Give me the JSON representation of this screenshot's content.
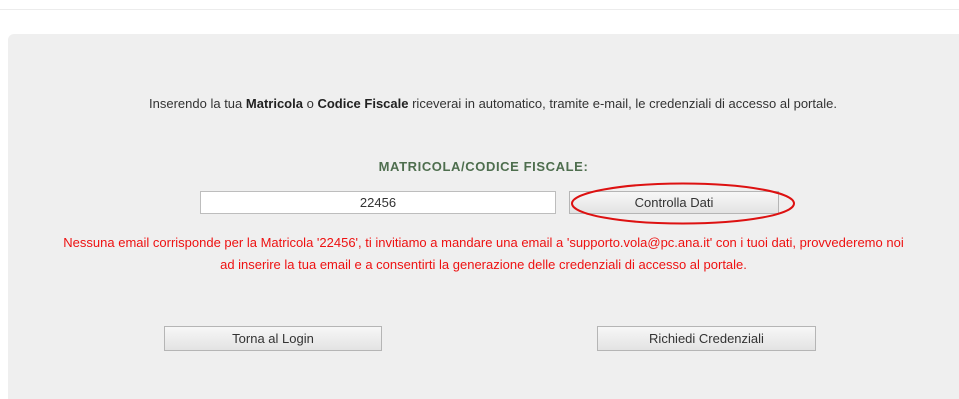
{
  "intro": {
    "part1": "Inserendo la tua ",
    "bold1": "Matricola",
    "part2": " o ",
    "bold2": "Codice Fiscale",
    "part3": " riceverai in automatico, tramite e-mail, le credenziali di accesso al portale."
  },
  "form": {
    "label": "MATRICOLA/CODICE FISCALE:",
    "input_value": "22456",
    "check_button": "Controlla Dati"
  },
  "error_message": "Nessuna email corrisponde per la Matricola '22456', ti invitiamo a mandare una email a 'supporto.vola@pc.ana.it' con i tuoi dati, provvederemo noi ad inserire la tua email e a consentirti la generazione delle credenziali di accesso al portale.",
  "actions": {
    "back_button": "Torna al Login",
    "request_button": "Richiedi Credenziali"
  },
  "colors": {
    "error": "#ee1111",
    "label": "#4e6e4e",
    "annotation": "#dd1111"
  }
}
